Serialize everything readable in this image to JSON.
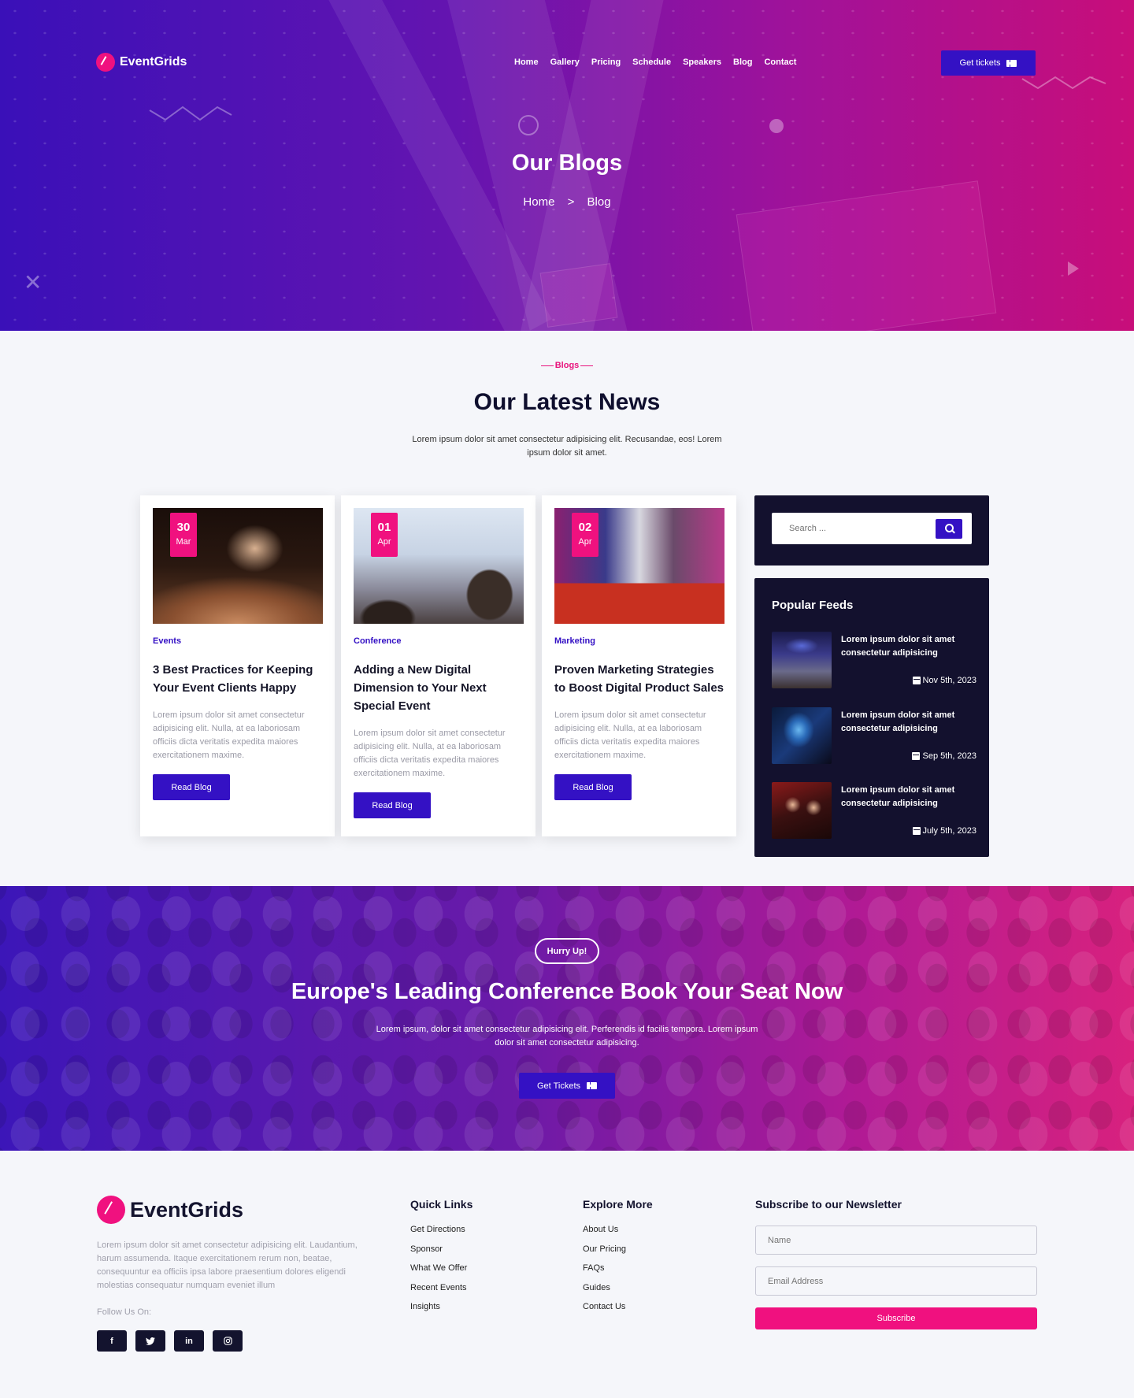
{
  "brand": {
    "name": "EventGrids"
  },
  "nav": {
    "items": [
      "Home",
      "Gallery",
      "Pricing",
      "Schedule",
      "Speakers",
      "Blog",
      "Contact"
    ],
    "cta_label": "Get tickets"
  },
  "hero": {
    "title": "Our Blogs",
    "breadcrumb": {
      "home": "Home",
      "separator": ">",
      "current": "Blog"
    }
  },
  "news": {
    "tag": "Blogs",
    "title": "Our Latest News",
    "description": "Lorem ipsum dolor sit amet consectetur adipisicing elit. Recusandae, eos! Lorem ipsum dolor sit amet."
  },
  "cards": [
    {
      "day": "30",
      "month": "Mar",
      "category": "Events",
      "title": "3 Best Practices for Keeping Your Event Clients Happy",
      "excerpt": "Lorem ipsum dolor sit amet consectetur adipisicing elit. Nulla, at ea laboriosam officiis dicta veritatis expedita maiores exercitationem maxime.",
      "button": "Read Blog"
    },
    {
      "day": "01",
      "month": "Apr",
      "category": "Conference",
      "title": "Adding a New Digital Dimension to Your Next Special Event",
      "excerpt": "Lorem ipsum dolor sit amet consectetur adipisicing elit. Nulla, at ea laboriosam officiis dicta veritatis expedita maiores exercitationem maxime.",
      "button": "Read Blog"
    },
    {
      "day": "02",
      "month": "Apr",
      "category": "Marketing",
      "title": "Proven Marketing Strategies to Boost Digital Product Sales",
      "excerpt": "Lorem ipsum dolor sit amet consectetur adipisicing elit. Nulla, at ea laboriosam officiis dicta veritatis expedita maiores exercitationem maxime.",
      "button": "Read Blog"
    }
  ],
  "sidebar": {
    "search_placeholder": "Search ...",
    "feeds_title": "Popular Feeds",
    "feeds": [
      {
        "title": "Lorem ipsum dolor sit amet consectetur adipisicing",
        "date": "Nov 5th, 2023"
      },
      {
        "title": "Lorem ipsum dolor sit amet consectetur adipisicing",
        "date": "Sep 5th, 2023"
      },
      {
        "title": "Lorem ipsum dolor sit amet consectetur adipisicing",
        "date": "July 5th, 2023"
      }
    ]
  },
  "cta": {
    "badge": "Hurry Up!",
    "title": "Europe's Leading Conference Book Your Seat Now",
    "description": "Lorem ipsum, dolor sit amet consectetur adipisicing elit. Perferendis id facilis tempora. Lorem ipsum dolor sit amet consectetur adipisicing.",
    "button": "Get Tickets"
  },
  "footer": {
    "brand": "EventGrids",
    "about": "Lorem ipsum dolor sit amet consectetur adipisicing elit. Laudantium, harum assumenda. Itaque exercitationem rerum non, beatae, consequuntur ea officiis ipsa labore praesentium dolores eligendi molestias consequatur numquam eveniet illum",
    "follow": "Follow Us On:",
    "socials": [
      "f",
      "t",
      "in",
      "ig"
    ],
    "quick_links": {
      "title": "Quick Links",
      "items": [
        "Get Directions",
        "Sponsor",
        "What We Offer",
        "Recent Events",
        "Insights"
      ]
    },
    "explore": {
      "title": "Explore More",
      "items": [
        "About Us",
        "Our Pricing",
        "FAQs",
        "Guides",
        "Contact Us"
      ]
    },
    "newsletter": {
      "title": "Subscribe to our Newsletter",
      "name_placeholder": "Name",
      "email_placeholder": "Email Address",
      "button": "Subscribe"
    }
  },
  "colors": {
    "primary": "#3411c4",
    "accent": "#f0117f",
    "dark": "#13112e"
  }
}
